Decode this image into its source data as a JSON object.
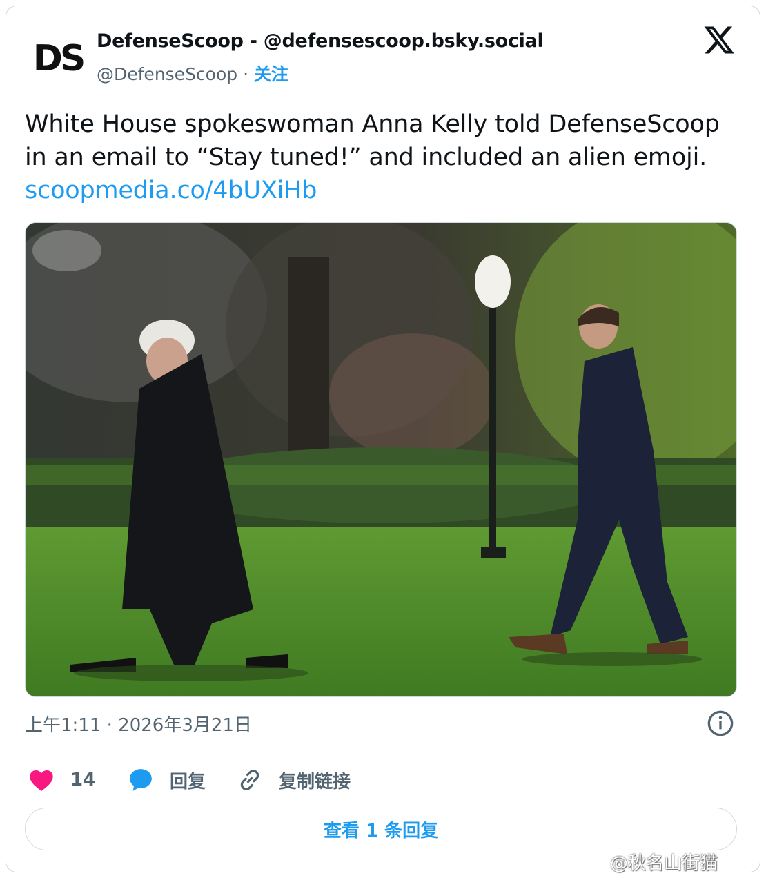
{
  "author": {
    "display_name": "DefenseScoop - @defensescoop.bsky.social",
    "handle": "@DefenseScoop",
    "separator": " · ",
    "follow_label": "关注",
    "avatar_text": "DS"
  },
  "tweet": {
    "text": "White House spokeswoman Anna Kelly told DefenseScoop in an email to “Stay tuned!” and included an alien emoji.",
    "link": "scoopmedia.co/4bUXiHb",
    "photo_alt": "Two men walking across a lawn"
  },
  "meta": {
    "timestamp": "上午1:11 · 2026年3月21日"
  },
  "actions": {
    "like_count": "14",
    "reply_label": "回复",
    "copy_link_label": "复制链接"
  },
  "more_replies_label": "查看 1 条回复",
  "watermark": "@秋名山街猫",
  "icons": {
    "brand": "x-logo-icon",
    "info": "info-icon",
    "like": "heart-icon",
    "reply": "chat-bubble-icon",
    "copy": "link-icon"
  },
  "colors": {
    "accent": "#1d9bf0",
    "like": "#f91880",
    "text": "#0f1419",
    "muted": "#536471",
    "border": "#cfd9de"
  }
}
